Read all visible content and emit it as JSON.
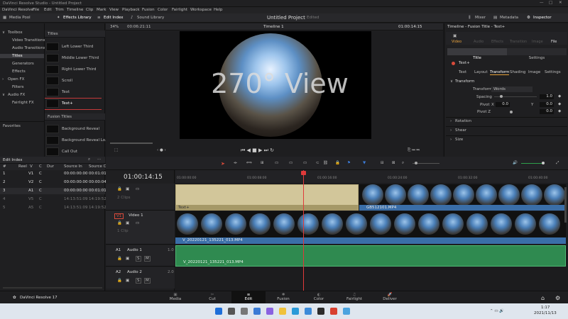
{
  "window": {
    "title": "DaVinci Resolve Studio - Untitled Project"
  },
  "menu": [
    "DaVinci Resolve",
    "File",
    "Edit",
    "Trim",
    "Timeline",
    "Clip",
    "Mark",
    "View",
    "Playback",
    "Fusion",
    "Color",
    "Fairlight",
    "Workspace",
    "Help"
  ],
  "toolbar": {
    "media_pool": "Media Pool",
    "effects_library": "Effects Library",
    "edit_index": "Edit Index",
    "sound_library": "Sound Library",
    "project_name": "Untitled Project",
    "edited": "Edited",
    "mixer": "Mixer",
    "metadata": "Metadata",
    "inspector": "Inspector"
  },
  "viewer_bar": {
    "zoom": "34%",
    "timecode_left": "00:06:21:11",
    "timeline_name": "Timeline 1",
    "timecode_right": "01:00:14:15"
  },
  "effects": {
    "tree": [
      {
        "label": "Toolbox",
        "caret": "∨"
      },
      {
        "label": "Video Transitions"
      },
      {
        "label": "Audio Transitions"
      },
      {
        "label": "Titles",
        "selected": true
      },
      {
        "label": "Generators"
      },
      {
        "label": "Effects"
      },
      {
        "label": "Open FX",
        "caret": "›"
      },
      {
        "label": "Filters"
      },
      {
        "label": "Audio FX",
        "caret": "∨"
      },
      {
        "label": "Fairlight FX"
      }
    ],
    "favorites": "Favorites",
    "titles_header": "Titles",
    "titles": [
      "Left Lower Third",
      "Middle Lower Third",
      "Right Lower Third",
      "Scroll",
      "Text",
      "Text+"
    ],
    "fusion_header": "Fusion Titles",
    "fusion_titles": [
      "Background Reveal",
      "Background Reveal Lo...",
      "Call Out"
    ]
  },
  "viewer": {
    "overlay_text": "270° View"
  },
  "inspector": {
    "header": "Timeline - Fusion Title - Text+",
    "tabs": [
      "Video",
      "Audio",
      "Effects",
      "Transition",
      "Image",
      "File"
    ],
    "sub_title": "Title",
    "sub_settings": "Settings",
    "clip_name": "Text+",
    "text_tabs": [
      "Text",
      "Layout",
      "Transform",
      "Shading",
      "Image",
      "Settings"
    ],
    "section_transform": "Transform",
    "transform_label": "Transform",
    "transform_value": "Words",
    "spacing_label": "Spacing",
    "spacing_value": "1.0",
    "pivot_label": "Pivot",
    "x_label": "X",
    "pivot_x": "0.0",
    "y_label": "Y",
    "pivot_y": "0.0",
    "pivot2_label": "Pivot Z",
    "pivot2_value": "0.0",
    "sections": [
      "Rotation",
      "Shear",
      "Size"
    ]
  },
  "edit_index": {
    "title": "Edit Index",
    "columns": [
      "#",
      "Reel",
      "V",
      "C",
      "Dur",
      "Source In",
      "Source Out"
    ],
    "rows": [
      [
        "1",
        "",
        "V1",
        "C",
        "",
        "00:00:00:00",
        "00:01:01:"
      ],
      [
        "2",
        "",
        "V2",
        "C",
        "",
        "00:00:00:00",
        "00:00:04:"
      ],
      [
        "3",
        "",
        "A1",
        "C",
        "",
        "00:00:00:00",
        "00:01:01:"
      ],
      [
        "4",
        "",
        "V5",
        "C",
        "",
        "14:13:51:09",
        "14:19:52:"
      ],
      [
        "5",
        "",
        "A5",
        "C",
        "",
        "14:13:51:09",
        "14:19:52:"
      ]
    ]
  },
  "timeline": {
    "timecode": "01:00:14:15",
    "ruler": [
      "01:00:00:00",
      "01:00:08:00",
      "01:00:16:00",
      "01:00:24:00",
      "01:00:32:00",
      "01:00:40:00"
    ],
    "tracks": {
      "v2_clips": "2 Clips",
      "v1_name": "Video 1",
      "v1_code": "V1",
      "v1_clips": "1 Clip",
      "a1_code": "A1",
      "a1_name": "Audio 1",
      "a1_level": "1.0",
      "a2_code": "A2",
      "a2_name": "Audio 2",
      "a2_level": "2.0"
    },
    "clips": {
      "title_clip": "Text+",
      "v2_clip": "GB512101.MP4",
      "v1_clip": "V_20220121_135221_013.MP4",
      "a1_clip": "V_20220121_135221_013.MP4"
    }
  },
  "pages": [
    "Media",
    "Cut",
    "Edit",
    "Fusion",
    "Color",
    "Fairlight",
    "Deliver"
  ],
  "pages_active": "Edit",
  "brand": "DaVinci Resolve 17",
  "taskbar": {
    "time": "1:17",
    "date": "2021/11/13"
  }
}
